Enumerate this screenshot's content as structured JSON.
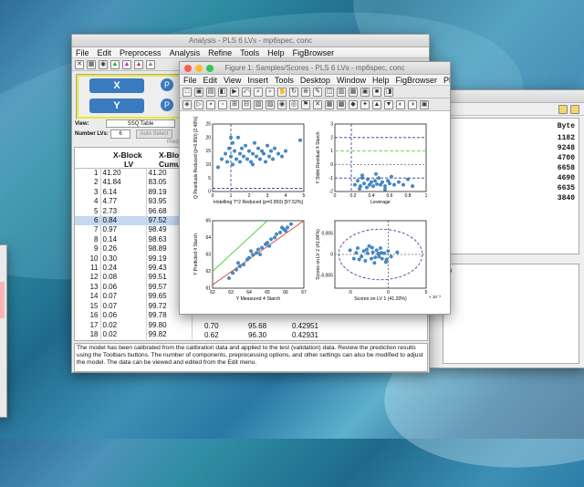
{
  "colors": {
    "accent": "#3a7bbf",
    "close": "#fc5f57",
    "minimize": "#fdbc2e",
    "zoom": "#34c84a",
    "fit_line": "#d6423b",
    "identity_line": "#3ecf3e",
    "limit_blue": "#27358f",
    "limit_green": "#6fd02b",
    "point": "#3e8fd0"
  },
  "analysis": {
    "title": "Analysis - PLS 6 LVs - mp6spec, conc",
    "menu": [
      "File",
      "Edit",
      "Preprocess",
      "Analysis",
      "Refine",
      "Tools",
      "Help",
      "FigBrowser"
    ],
    "blocks": {
      "x": "X",
      "y": "Y",
      "p1": "P",
      "p2": "P"
    },
    "view_label": "View:",
    "view_value": "SSQ Table",
    "lvs_label": "Number LVs:",
    "lvs_value": "6",
    "auto_select": "Auto Select",
    "pred_text": "Pred",
    "col_headers": {
      "c1a": "X-Block",
      "c1b": "LV",
      "c2a": "X-Blo",
      "c2b": "Cumu"
    },
    "rows": [
      {
        "n": "1",
        "a": "41.20",
        "b": "41.20"
      },
      {
        "n": "2",
        "a": "41.84",
        "b": "83.05"
      },
      {
        "n": "3",
        "a": "6.14",
        "b": "89.19"
      },
      {
        "n": "4",
        "a": "4.77",
        "b": "93.95"
      },
      {
        "n": "5",
        "a": "2.73",
        "b": "96.68"
      },
      {
        "n": "6",
        "a": "0.84",
        "b": "97.52"
      },
      {
        "n": "7",
        "a": "0.97",
        "b": "98.49"
      },
      {
        "n": "8",
        "a": "0.14",
        "b": "98.63"
      },
      {
        "n": "9",
        "a": "0.26",
        "b": "98.89"
      },
      {
        "n": "10",
        "a": "0.30",
        "b": "99.19"
      },
      {
        "n": "11",
        "a": "0.24",
        "b": "99.43"
      },
      {
        "n": "12",
        "a": "0.08",
        "b": "99.51"
      },
      {
        "n": "13",
        "a": "0.06",
        "b": "99.57"
      },
      {
        "n": "14",
        "a": "0.07",
        "b": "99.65"
      },
      {
        "n": "15",
        "a": "0.07",
        "b": "99.72"
      },
      {
        "n": "16",
        "a": "0.06",
        "b": "99.78"
      },
      {
        "n": "17",
        "a": "0.02",
        "b": "99.80"
      },
      {
        "n": "18",
        "a": "0.02",
        "b": "99.82"
      }
    ],
    "extra_rows": [
      {
        "c": "0.70",
        "d": "95.68",
        "e": "0.42951"
      },
      {
        "c": "0.62",
        "d": "96.30",
        "e": "0.42931"
      }
    ],
    "status": "The model has been calibrated from the calibration data and applied to the test (validation) data. Review the prediction results using the Toolbars buttons. The number of components, preprocessing options, and other settings can also be modified to adjust the model. The data can be viewed and edited from the Edit menu."
  },
  "right_window": {
    "header": "Byte",
    "bytes": [
      "1182",
      "9248",
      "4700",
      "6658",
      "4690",
      "6635",
      "3840"
    ],
    "side_glyph": "e)"
  },
  "figure": {
    "title": "Figure 1: Samples/Scores - PLS 6 LVs - mp6spec, conc",
    "menu": [
      "File",
      "Edit",
      "View",
      "Insert",
      "Tools",
      "Desktop",
      "Window",
      "Help",
      "FigBrowser",
      "PlotGUI"
    ],
    "plots": [
      {
        "id": "q_vs_t2",
        "xlabel": "Hotelling T^2 Reduced (p=0.950) [97.52%]",
        "ylabel": "Q Residuals Reduced (p=0.950) [2.48%]",
        "xticks": [
          "0",
          "1",
          "2",
          "3",
          "4",
          "5"
        ],
        "yticks": [
          "0",
          "5",
          "10",
          "15",
          "20",
          "25"
        ]
      },
      {
        "id": "stud_vs_lev",
        "xlabel": "Leverage",
        "ylabel": "Y Stdnt Residual 4 Starch",
        "xticks": [
          "0",
          "0.2",
          "0.4",
          "0.6",
          "0.8",
          "1"
        ],
        "yticks": [
          "-2",
          "-1",
          "0",
          "1",
          "2",
          "3"
        ]
      },
      {
        "id": "pred_vs_meas",
        "xlabel": "Y Measured 4 Starch",
        "ylabel": "Y Predicted 4 Starch",
        "xticks": [
          "62",
          "63",
          "64",
          "65",
          "66",
          "67"
        ],
        "yticks": [
          "61",
          "62",
          "63",
          "64",
          "65"
        ]
      },
      {
        "id": "scores",
        "xlabel": "Scores on LV 1 (41.20%)",
        "ylabel": "Scores on LV 2 (41.84%)",
        "xticks": [
          "-5",
          "0",
          "5"
        ],
        "yticks": [
          "-0.005",
          "0",
          "0.005"
        ],
        "xexp": "× 10⁻³"
      }
    ]
  },
  "chart_data": [
    {
      "type": "scatter",
      "xlabel": "Hotelling T^2 Reduced (p=0.950) [97.52%]",
      "ylabel": "Q Residuals Reduced (p=0.950) [2.48%]",
      "xlim": [
        0,
        5
      ],
      "ylim": [
        0,
        25
      ],
      "points": [
        [
          0.5,
          12
        ],
        [
          0.7,
          14
        ],
        [
          0.8,
          11
        ],
        [
          0.9,
          16
        ],
        [
          1.0,
          13
        ],
        [
          1.1,
          18
        ],
        [
          1.1,
          10
        ],
        [
          1.2,
          15
        ],
        [
          1.3,
          12
        ],
        [
          1.4,
          20
        ],
        [
          1.5,
          14
        ],
        [
          1.5,
          11
        ],
        [
          1.6,
          16
        ],
        [
          1.7,
          13
        ],
        [
          1.8,
          17
        ],
        [
          1.9,
          12
        ],
        [
          2.0,
          15
        ],
        [
          2.1,
          11
        ],
        [
          2.2,
          14
        ],
        [
          2.3,
          18
        ],
        [
          2.4,
          13
        ],
        [
          2.5,
          16
        ],
        [
          2.6,
          12
        ],
        [
          2.7,
          15
        ],
        [
          2.8,
          14
        ],
        [
          2.9,
          11
        ],
        [
          3.0,
          17
        ],
        [
          3.1,
          13
        ],
        [
          3.2,
          15
        ],
        [
          3.3,
          12
        ],
        [
          3.4,
          16
        ],
        [
          3.6,
          14
        ],
        [
          3.8,
          13
        ],
        [
          4.0,
          15
        ],
        [
          1.0,
          20
        ],
        [
          2.2,
          10
        ],
        [
          0.3,
          9
        ],
        [
          4.8,
          19
        ]
      ]
    },
    {
      "type": "scatter",
      "xlabel": "Leverage",
      "ylabel": "Y Stdnt Residual 4 Starch",
      "xlim": [
        0,
        1
      ],
      "ylim": [
        -2,
        3
      ],
      "points": [
        [
          0.22,
          -1.5
        ],
        [
          0.25,
          -1.2
        ],
        [
          0.28,
          -1.6
        ],
        [
          0.3,
          -1.0
        ],
        [
          0.32,
          -1.4
        ],
        [
          0.35,
          -1.7
        ],
        [
          0.36,
          -1.1
        ],
        [
          0.38,
          -1.5
        ],
        [
          0.4,
          -1.3
        ],
        [
          0.42,
          -1.6
        ],
        [
          0.44,
          -1.2
        ],
        [
          0.46,
          -1.45
        ],
        [
          0.48,
          -1.0
        ],
        [
          0.5,
          -1.5
        ],
        [
          0.52,
          -1.3
        ],
        [
          0.55,
          -1.6
        ],
        [
          0.58,
          -1.2
        ],
        [
          0.6,
          -1.4
        ],
        [
          0.62,
          -0.9
        ],
        [
          0.65,
          -1.5
        ],
        [
          0.7,
          -1.3
        ],
        [
          0.75,
          -1.5
        ],
        [
          0.8,
          -1.1
        ],
        [
          0.85,
          -1.6
        ],
        [
          0.3,
          -0.8
        ],
        [
          0.45,
          -0.7
        ],
        [
          0.27,
          -1.8
        ],
        [
          0.55,
          -1.85
        ]
      ]
    },
    {
      "type": "scatter",
      "xlabel": "Y Measured 4 Starch",
      "ylabel": "Y Predicted 4 Starch",
      "xlim": [
        62,
        67
      ],
      "ylim": [
        61,
        65
      ],
      "points": [
        [
          62.9,
          61.6
        ],
        [
          63.1,
          61.9
        ],
        [
          63.3,
          62.1
        ],
        [
          63.5,
          62.3
        ],
        [
          63.7,
          62.4
        ],
        [
          63.9,
          62.7
        ],
        [
          64.0,
          62.8
        ],
        [
          64.2,
          63.0
        ],
        [
          64.4,
          63.1
        ],
        [
          64.5,
          63.3
        ],
        [
          64.7,
          63.4
        ],
        [
          64.9,
          63.6
        ],
        [
          65.0,
          63.7
        ],
        [
          65.2,
          63.9
        ],
        [
          65.4,
          64.0
        ],
        [
          65.5,
          64.2
        ],
        [
          65.7,
          64.3
        ],
        [
          65.9,
          64.5
        ],
        [
          66.1,
          64.6
        ],
        [
          66.3,
          64.8
        ],
        [
          64.1,
          63.2
        ],
        [
          65.1,
          63.5
        ],
        [
          63.4,
          62.5
        ],
        [
          65.8,
          64.6
        ],
        [
          64.6,
          63.0
        ],
        [
          66.0,
          64.4
        ]
      ]
    },
    {
      "type": "scatter",
      "xlabel": "Scores on LV 1 (41.20%)",
      "ylabel": "Scores on LV 2 (41.84%)",
      "xlim": [
        -7,
        5
      ],
      "ylim": [
        -0.008,
        0.008
      ],
      "points": [
        [
          -5,
          0.001
        ],
        [
          -4.5,
          -0.001
        ],
        [
          -4,
          0.0015
        ],
        [
          -3.5,
          -0.0005
        ],
        [
          -3.2,
          0.0008
        ],
        [
          -3,
          -0.0015
        ],
        [
          -2.7,
          0.0003
        ],
        [
          -2.5,
          0.002
        ],
        [
          -2.2,
          -0.001
        ],
        [
          -2,
          0.0005
        ],
        [
          -1.8,
          -0.002
        ],
        [
          -1.5,
          0.001
        ],
        [
          -1.2,
          -0.0005
        ],
        [
          -1,
          0.0015
        ],
        [
          -0.8,
          -0.001
        ],
        [
          -0.5,
          0.0003
        ],
        [
          -0.3,
          -0.0018
        ],
        [
          0,
          0.0008
        ],
        [
          0.4,
          -0.0005
        ],
        [
          -2.8,
          0.0012
        ],
        [
          -1.7,
          -0.0007
        ],
        [
          -0.9,
          0.0004
        ],
        [
          -3.8,
          -0.0012
        ],
        [
          -2.1,
          0.0016
        ],
        [
          -1.3,
          0.0002
        ],
        [
          -0.2,
          -0.0012
        ],
        [
          1.2,
          0.0005
        ],
        [
          -4.2,
          0.0004
        ]
      ]
    }
  ]
}
